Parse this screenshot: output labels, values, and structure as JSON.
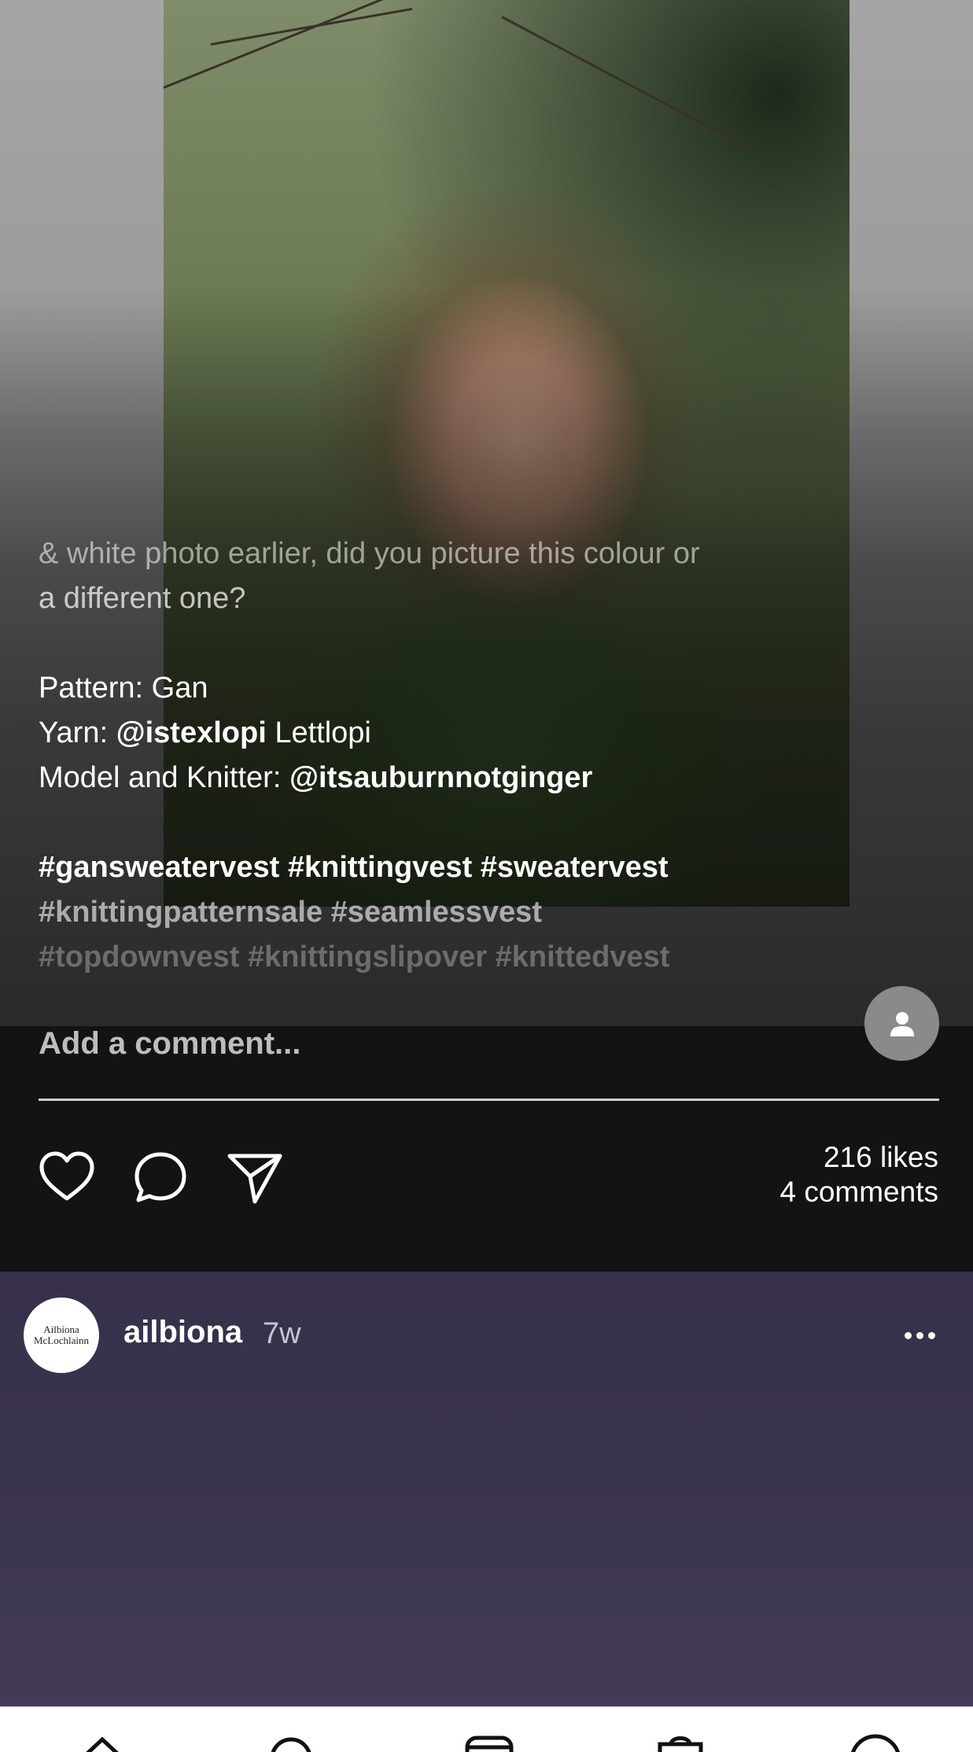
{
  "post": {
    "caption": {
      "line_faded": "& white photo earlier, did you picture this colour or",
      "line_2": "a different one?",
      "pattern_label": "Pattern: Gan",
      "yarn_label": "Yarn: ",
      "yarn_mention": "@istexlopi",
      "yarn_name": " Lettlopi",
      "model_label": "Model and Knitter: ",
      "model_mention": "@itsauburnnotginger",
      "tags_line_1": "#gansweatervest #knittingvest #sweatervest",
      "tags_line_2": "#knittingpatternsale #seamlessvest",
      "tags_line_3": "#topdownvest #knittingslipover #knittedvest"
    },
    "comment_placeholder": "Add a comment...",
    "actions": {
      "like_icon": "heart-icon",
      "comment_icon": "speech-bubble-icon",
      "share_icon": "paper-plane-icon"
    },
    "likes": "216 likes",
    "comments": "4 comments"
  },
  "next_post": {
    "avatar_text_1": "Ailbíona",
    "avatar_text_2": "McLochlainn",
    "username": "ailbiona",
    "time": "7w",
    "more_icon": "ellipsis-icon"
  },
  "bottom_nav": {
    "items": [
      "home-icon",
      "search-icon",
      "reels-icon",
      "shop-icon",
      "profile-icon"
    ]
  },
  "colors": {
    "post_bg": "#121312",
    "next_post_bg": "#3c3551",
    "fab": "#8a8a8a"
  }
}
